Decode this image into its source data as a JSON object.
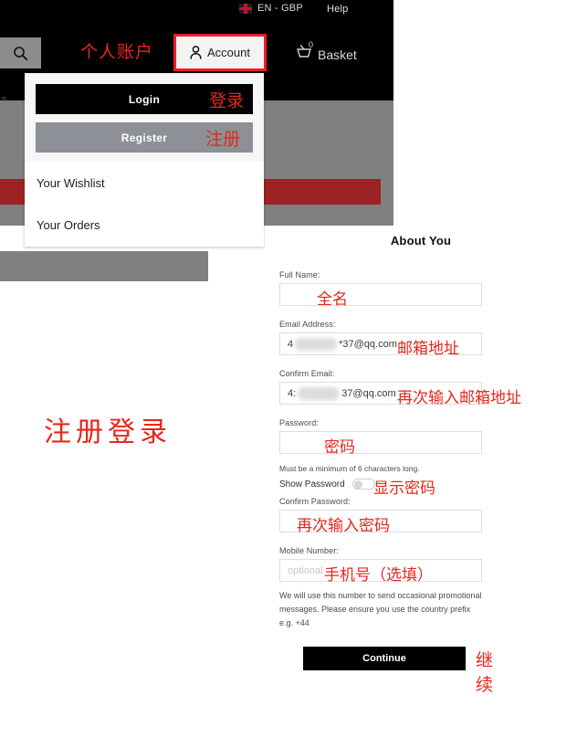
{
  "header": {
    "locale": "EN - GBP",
    "help": "Help",
    "account_label": "Account",
    "basket_label": "Basket",
    "basket_count": "0",
    "annotation_account_cn": "个人账户"
  },
  "dropdown": {
    "login_label": "Login",
    "login_cn": "登录",
    "register_label": "Register",
    "register_cn": "注册",
    "items": [
      {
        "label": "Your Wishlist"
      },
      {
        "label": "Your Orders"
      }
    ]
  },
  "left_annotation": "注册登录",
  "edge_fragment": "s",
  "form": {
    "title": "About You",
    "fields": [
      {
        "label": "Full Name:",
        "value": "",
        "placeholder": "",
        "annotation_cn": "全名"
      },
      {
        "label": "Email Address:",
        "value_prefix": "4",
        "value_suffix": "*37@qq.com",
        "placeholder": "",
        "annotation_cn": "邮箱地址"
      },
      {
        "label": "Confirm Email:",
        "value_prefix": "4:",
        "value_suffix": "37@qq.com",
        "placeholder": "",
        "annotation_cn": "再次输入邮箱地址"
      },
      {
        "label": "Password:",
        "value": "",
        "placeholder": "",
        "annotation_cn": "密码"
      },
      {
        "label": "Confirm Password:",
        "value": "",
        "placeholder": "",
        "annotation_cn": "再次输入密码"
      },
      {
        "label": "Mobile Number:",
        "value": "",
        "placeholder": "optional",
        "annotation_cn": "手机号（选填）"
      }
    ],
    "password_hint": "Must be a minimum of 6 characters long.",
    "show_password_label": "Show Password",
    "show_password_cn": "显示密码",
    "show_password_on": false,
    "mobile_note": "We will use this number to send occasional promotional messages. Please ensure you use the country prefix e.g. +44",
    "continue_label": "Continue",
    "continue_cn": "继续"
  },
  "colors": {
    "annotation_red": "#e8261c",
    "brand_red": "#9e2223",
    "header_black": "#000000",
    "grey_band": "#808080",
    "register_grey": "#8d9096"
  }
}
